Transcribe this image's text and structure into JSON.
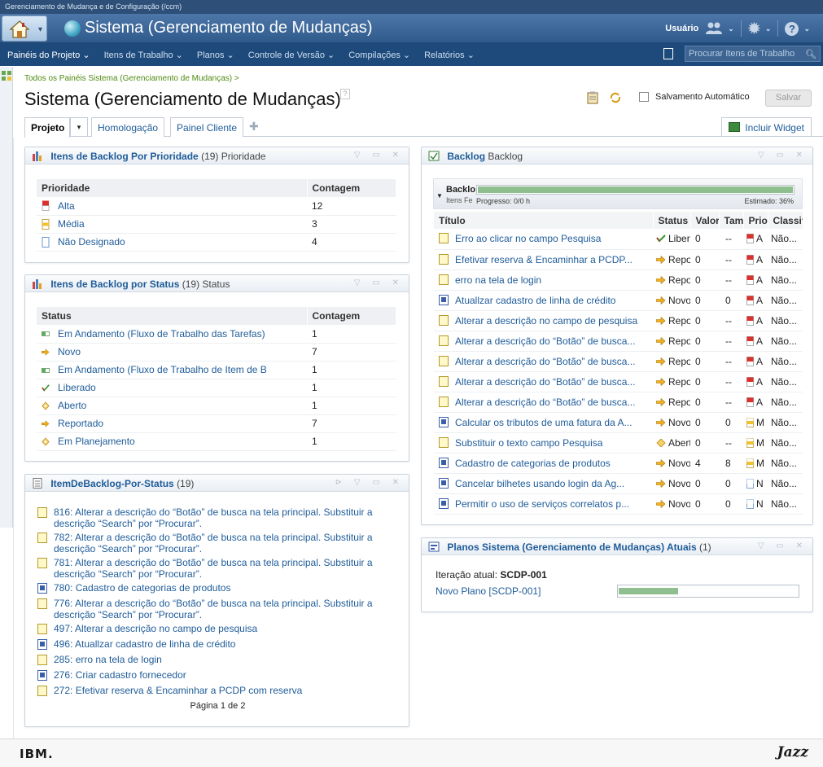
{
  "window_title": "Gerenciamento de Mudança e de Configuração (/ccm)",
  "banner": {
    "title": "Sistema (Gerenciamento de Mudanças)",
    "user_label": "Usuário"
  },
  "menu": [
    "Painéis do Projeto",
    "Itens de Trabalho",
    "Planos",
    "Controle de Versão",
    "Compilações",
    "Relatórios"
  ],
  "search": {
    "placeholder": "Procurar Itens de Trabalho"
  },
  "breadcrumb": "Todos os Painéis Sistema (Gerenciamento de Mudanças) >",
  "page_title": "Sistema (Gerenciamento de Mudanças)",
  "autosave_label": "Salvamento Automático",
  "save_label": "Salvar",
  "tabs": [
    "Projeto",
    "Homologação",
    "Painel Cliente"
  ],
  "add_widget_label": "Incluir Widget",
  "widget_priority": {
    "title": "Itens de Backlog Por Prioridade",
    "count": "(19)",
    "subtitle": "Prioridade",
    "col1": "Prioridade",
    "col2": "Contagem",
    "rows": [
      {
        "label": "Alta",
        "count": "12",
        "icon": "priority-high-icon"
      },
      {
        "label": "Média",
        "count": "3",
        "icon": "priority-medium-icon"
      },
      {
        "label": "Não Designado",
        "count": "4",
        "icon": "priority-unassigned-icon"
      }
    ]
  },
  "widget_status": {
    "title": "Itens de Backlog por Status",
    "count": "(19)",
    "subtitle": "Status",
    "col1": "Status",
    "col2": "Contagem",
    "rows": [
      {
        "label": "Em Andamento (Fluxo de Trabalho das Tarefas)",
        "count": "1",
        "icon": "in-progress-icon"
      },
      {
        "label": "Novo",
        "count": "7",
        "icon": "new-arrow-icon"
      },
      {
        "label": "Em Andamento (Fluxo de Trabalho de Item de B",
        "count": "1",
        "icon": "in-progress-icon"
      },
      {
        "label": "Liberado",
        "count": "1",
        "icon": "released-check-icon"
      },
      {
        "label": "Aberto",
        "count": "1",
        "icon": "open-diamond-icon"
      },
      {
        "label": "Reportado",
        "count": "7",
        "icon": "reported-arrow-icon"
      },
      {
        "label": "Em Planejamento",
        "count": "1",
        "icon": "planning-diamond-icon"
      }
    ]
  },
  "widget_list": {
    "title": "ItemDeBacklog-Por-Status",
    "count": "(19)",
    "items": [
      {
        "text": "816: Alterar a descrição do “Botão” de busca na tela principal. Substituir a",
        "text2": "descrição “Search” por “Procurar”.",
        "icon": "task"
      },
      {
        "text": "782: Alterar a descrição do “Botão” de busca na tela principal. Substituir a",
        "text2": "descrição “Search” por “Procurar”.",
        "icon": "task"
      },
      {
        "text": "781: Alterar a descrição do “Botão” de busca na tela principal. Substituir a",
        "text2": "descrição “Search” por “Procurar”.",
        "icon": "task"
      },
      {
        "text": "780: Cadastro de categorias de produtos",
        "text2": "",
        "icon": "story"
      },
      {
        "text": "776: Alterar a descrição do “Botão” de busca na tela principal. Substituir a",
        "text2": "descrição “Search” por “Procurar”.",
        "icon": "task"
      },
      {
        "text": "497: Alterar a descrição no campo de pesquisa",
        "text2": "",
        "icon": "task"
      },
      {
        "text": "496: Atuallzar cadastro de linha de crédito",
        "text2": "",
        "icon": "story"
      },
      {
        "text": "285: erro na tela de login",
        "text2": "",
        "icon": "task"
      },
      {
        "text": "276: Criar cadastro fornecedor",
        "text2": "",
        "icon": "story"
      },
      {
        "text": "272: Efetivar reserva & Encaminhar a PCDP com reserva",
        "text2": "",
        "icon": "task"
      }
    ],
    "pager": "Página 1 de 2"
  },
  "widget_backlog": {
    "title": "Backlog",
    "subtitle": "Backlog",
    "group_title": "Backlo",
    "group_sub": "Itens Fe",
    "progress_label": "Progresso: 0/0 h",
    "estimated_label": "Estimado: 36%",
    "progress_fraction": 0.0,
    "estimated_fraction": 0.36,
    "columns": [
      "Título",
      "Status",
      "Valor",
      "Tam",
      "Prio",
      "Classif"
    ],
    "rows": [
      {
        "title": "Erro ao clicar no campo Pesquisa",
        "status": "Liberado",
        "value": "0",
        "size": "--",
        "prio": "A",
        "classif": "Não...",
        "icon": "tree",
        "sicon": "check",
        "picon": "high"
      },
      {
        "title": "Efetivar reserva & Encaminhar a PCDP...",
        "status": "Reportado",
        "value": "0",
        "size": "--",
        "prio": "A",
        "classif": "Não...",
        "icon": "task",
        "sicon": "arrow",
        "picon": "high"
      },
      {
        "title": "erro na tela de login",
        "status": "Reportado",
        "value": "0",
        "size": "--",
        "prio": "A",
        "classif": "Não...",
        "icon": "task",
        "sicon": "arrow",
        "picon": "high"
      },
      {
        "title": "Atuallzar cadastro de linha de crédito",
        "status": "Novo",
        "value": "0",
        "size": "0",
        "prio": "A",
        "classif": "Não...",
        "icon": "story",
        "sicon": "arrow",
        "picon": "high"
      },
      {
        "title": "Alterar a descrição no campo de pesquisa",
        "status": "Reportado",
        "value": "0",
        "size": "--",
        "prio": "A",
        "classif": "Não...",
        "icon": "task",
        "sicon": "arrow",
        "picon": "high"
      },
      {
        "title": "Alterar a descrição do “Botão” de busca...",
        "status": "Reportado",
        "value": "0",
        "size": "--",
        "prio": "A",
        "classif": "Não...",
        "icon": "task",
        "sicon": "arrow",
        "picon": "high"
      },
      {
        "title": "Alterar a descrição do “Botão” de busca...",
        "status": "Reportado",
        "value": "0",
        "size": "--",
        "prio": "A",
        "classif": "Não...",
        "icon": "task",
        "sicon": "arrow",
        "picon": "high"
      },
      {
        "title": "Alterar a descrição do “Botão” de busca...",
        "status": "Reportado",
        "value": "0",
        "size": "--",
        "prio": "A",
        "classif": "Não...",
        "icon": "task",
        "sicon": "arrow",
        "picon": "high"
      },
      {
        "title": "Alterar a descrição do “Botão” de busca...",
        "status": "Reportado",
        "value": "0",
        "size": "--",
        "prio": "A",
        "classif": "Não...",
        "icon": "task",
        "sicon": "arrow",
        "picon": "high"
      },
      {
        "title": "Calcular os tributos de uma fatura da A...",
        "status": "Novo",
        "value": "0",
        "size": "0",
        "prio": "M",
        "classif": "Não...",
        "icon": "story",
        "sicon": "arrow",
        "picon": "medium"
      },
      {
        "title": "Substituir o texto campo Pesquisa",
        "status": "Aberto",
        "value": "0",
        "size": "--",
        "prio": "M",
        "classif": "Não...",
        "icon": "task",
        "sicon": "diamond",
        "picon": "medium"
      },
      {
        "title": "Cadastro de categorias de produtos",
        "status": "Novo",
        "value": "4",
        "size": "8",
        "prio": "M",
        "classif": "Não...",
        "icon": "story",
        "sicon": "arrow",
        "picon": "medium"
      },
      {
        "title": "Cancelar  bilhetes usando login da Ag...",
        "status": "Novo",
        "value": "0",
        "size": "0",
        "prio": "N",
        "classif": "Não...",
        "icon": "story",
        "sicon": "arrow",
        "picon": "none"
      },
      {
        "title": "Permitir o uso de serviços correlatos p...",
        "status": "Novo",
        "value": "0",
        "size": "0",
        "prio": "N",
        "classif": "Não...",
        "icon": "story",
        "sicon": "arrow",
        "picon": "none"
      }
    ]
  },
  "widget_plans": {
    "title": "Planos Sistema (Gerenciamento de Mudanças) Atuais",
    "count": "(1)",
    "iteration_label": "Iteração atual:",
    "iteration_value": "SCDP-001",
    "plan_link": "Novo Plano [SCDP-001]",
    "plan_progress_fraction": 0.33
  },
  "footer": {
    "ibm": "IBM.",
    "jazz": "Jazz"
  },
  "colors": {
    "banner": "#2f5a8c",
    "menubar": "#1e4a7b",
    "link": "#1f5c99",
    "progress": "#8fbf8f"
  }
}
